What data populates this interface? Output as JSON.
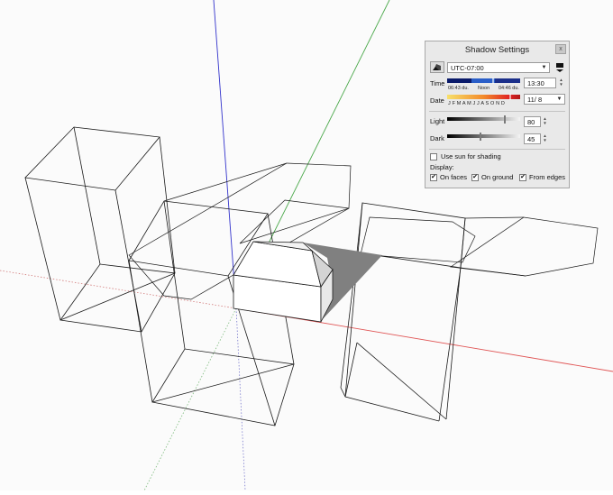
{
  "panel": {
    "title": "Shadow Settings",
    "close_label": "x",
    "timezone": "UTC-07:00",
    "time_label": "Time",
    "sunrise": "06:43 du.",
    "noon": "Noon",
    "sunset": "04:46 du.",
    "time_value": "13:30",
    "date_label": "Date",
    "months": "J F M A M J J A S O N D",
    "date_value": "11/ 8",
    "light_label": "Light",
    "light_value": "80",
    "light_level": 0.8,
    "dark_label": "Dark",
    "dark_value": "45",
    "dark_level": 0.45,
    "use_sun_label": "Use sun for shading",
    "use_sun_checked": false,
    "display_label": "Display:",
    "on_faces_label": "On faces",
    "on_ground_label": "On ground",
    "from_edges_label": "From edges",
    "on_faces_checked": true,
    "on_ground_checked": true,
    "from_edges_checked": true,
    "check_mark": "✔"
  },
  "colors": {
    "axis_red": "#e05555",
    "axis_green": "#4aa84a",
    "axis_blue": "#3333cc",
    "edge": "#1a1a1a",
    "shadow": "#808080"
  }
}
